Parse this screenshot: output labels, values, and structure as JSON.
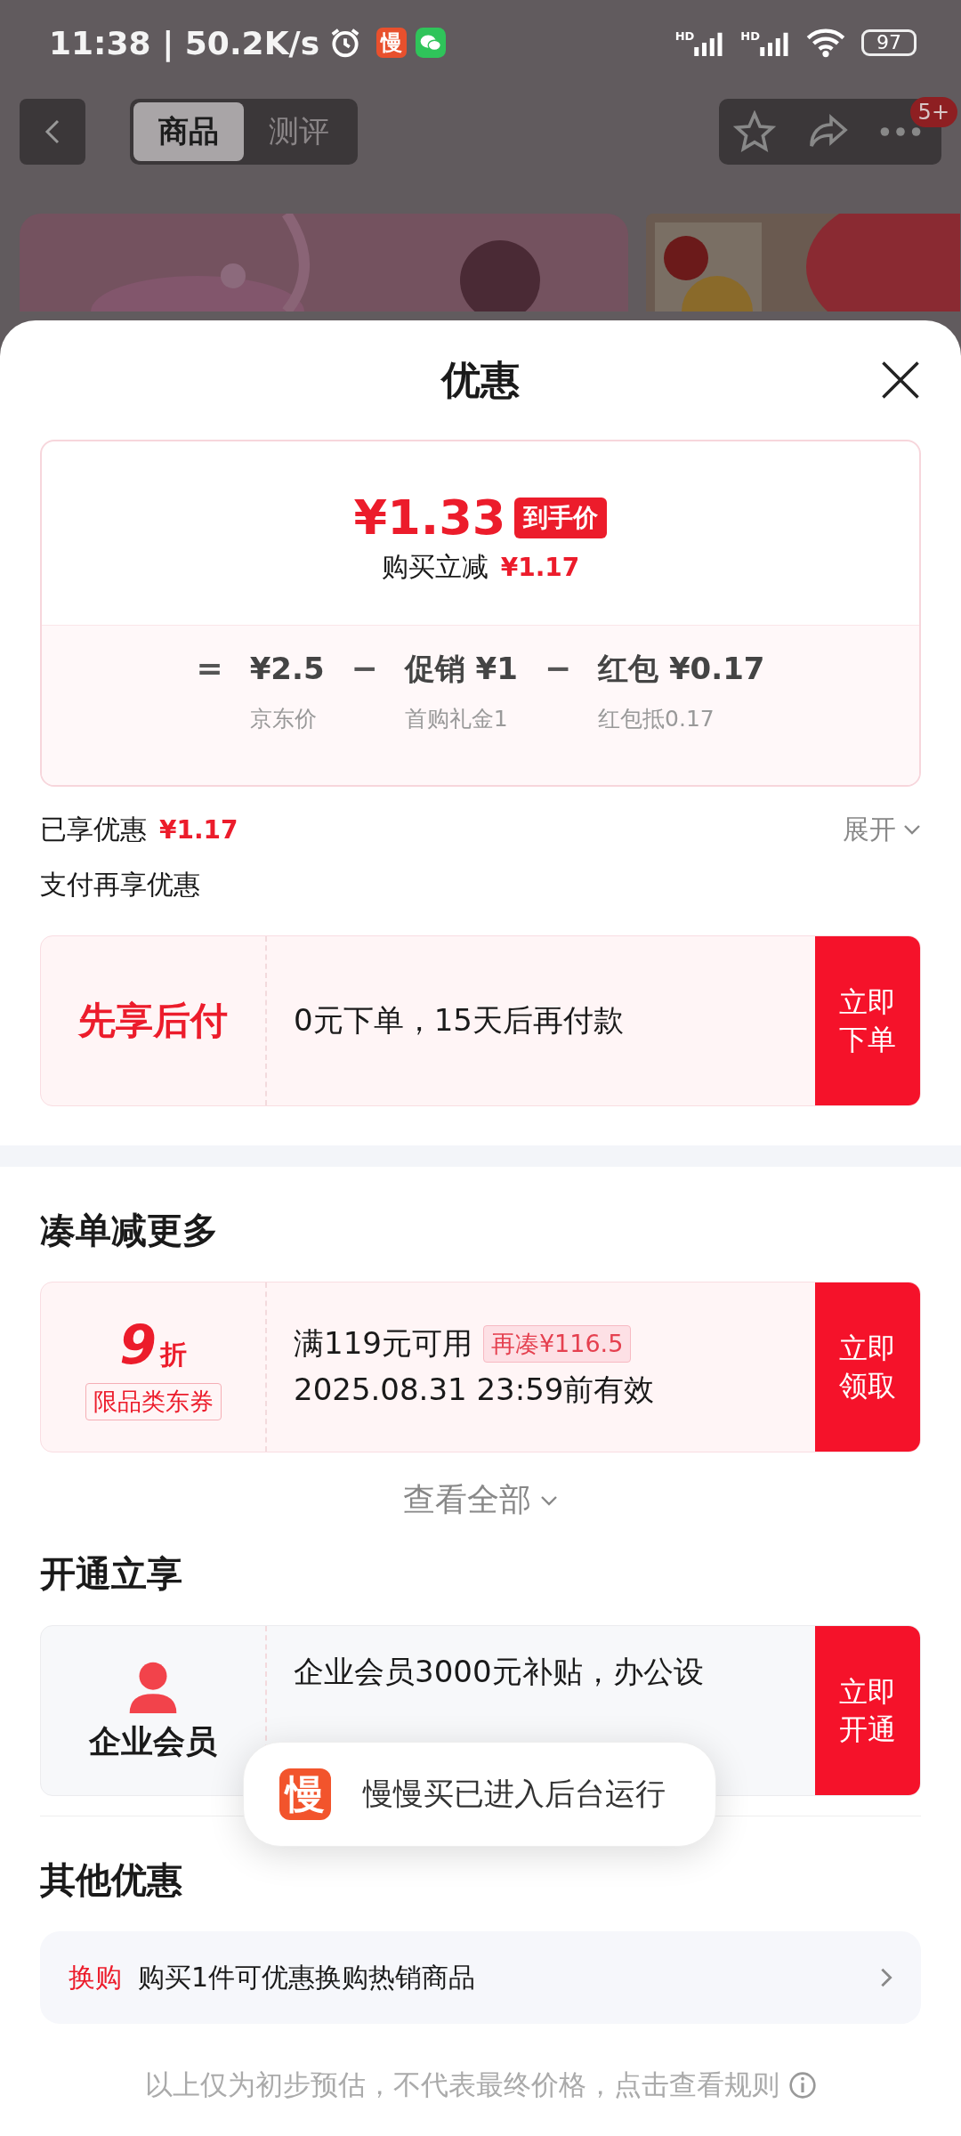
{
  "status_bar": {
    "time": "11:38 | 50.2K/s",
    "app_glyph": "慢",
    "signal_labels": [
      "HD",
      "HD"
    ],
    "battery": "97"
  },
  "header": {
    "tabs": [
      {
        "label": "商品",
        "selected": true
      },
      {
        "label": "测评",
        "selected": false
      }
    ],
    "badge": "5+"
  },
  "sheet": {
    "title": "优惠",
    "price_card": {
      "price": "¥1.33",
      "price_tag": "到手价",
      "saving_label": "购买立减",
      "saving": "¥1.17",
      "formula": [
        {
          "kind": "equals",
          "symbol": "="
        },
        {
          "kind": "term",
          "value": "¥2.5",
          "note": "京东价"
        },
        {
          "kind": "minus",
          "symbol": "−"
        },
        {
          "kind": "term",
          "value": "促销 ¥1",
          "note": "首购礼金1"
        },
        {
          "kind": "minus",
          "symbol": "−"
        },
        {
          "kind": "term",
          "value": "红包 ¥0.17",
          "note": "红包抵0.17"
        }
      ]
    },
    "enjoyed": {
      "label": "已享优惠",
      "amount": "¥1.17",
      "expand": "展开"
    },
    "pay_section": {
      "title": "支付再享优惠",
      "card": {
        "left": "先享后付",
        "text": "0元下单，15天后再付款",
        "button": "立即下单"
      }
    },
    "combine_section": {
      "title": "凑单减更多",
      "coupon": {
        "discount": "9",
        "unit": "折",
        "scope": "限品类东券",
        "condition": "满119元可用",
        "gap": "再凑¥116.5",
        "validity": "2025.08.31 23:59前有效",
        "button": "立即领取"
      },
      "see_all": "查看全部"
    },
    "member_section": {
      "title": "开通立享",
      "card": {
        "left": "企业会员",
        "text": "企业会员3000元补贴，办公设",
        "button": "立即开通"
      }
    },
    "other_section": {
      "title": "其他优惠",
      "row": {
        "tag": "换购",
        "text": "购买1件可优惠换购热销商品"
      }
    },
    "footer": "以上仅为初步预估，不代表最终价格，点击查看规则"
  },
  "toast": {
    "glyph": "慢",
    "text": "慢慢买已进入后台运行"
  }
}
